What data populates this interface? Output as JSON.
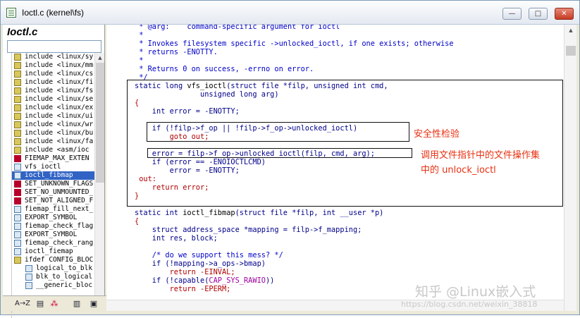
{
  "window": {
    "title": "Ioctl.c (kernel\\fs)",
    "minimize_label": "—",
    "maximize_label": "□",
    "close_label": "✕"
  },
  "left_panel": {
    "file_name": "Ioctl.c",
    "symbols": [
      {
        "icon": "include",
        "label": "include <linux/sy"
      },
      {
        "icon": "include",
        "label": "include <linux/mm"
      },
      {
        "icon": "include",
        "label": "include <linux/cs"
      },
      {
        "icon": "include",
        "label": "include <linux/fi"
      },
      {
        "icon": "include",
        "label": "include <linux/fs"
      },
      {
        "icon": "include",
        "label": "include <linux/se"
      },
      {
        "icon": "include",
        "label": "include <linux/ex"
      },
      {
        "icon": "include",
        "label": "include <linux/ui"
      },
      {
        "icon": "include",
        "label": "include <linux/wr"
      },
      {
        "icon": "include",
        "label": "include <linux/bu"
      },
      {
        "icon": "include",
        "label": "include <linux/fa"
      },
      {
        "icon": "include",
        "label": "include <asm/ioc"
      },
      {
        "icon": "define",
        "label": "FIEMAP_MAX_EXTEN"
      },
      {
        "icon": "function",
        "label": "vfs_ioctl"
      },
      {
        "icon": "function",
        "label": "ioctl_fibmap",
        "selected": true
      },
      {
        "icon": "define",
        "label": "SET_UNKNOWN_FLAGS"
      },
      {
        "icon": "define",
        "label": "SET_NO_UNMOUNTED_"
      },
      {
        "icon": "define",
        "label": "SET_NOT_ALIGNED_F"
      },
      {
        "icon": "function",
        "label": "fiemap_fill_next_"
      },
      {
        "icon": "function",
        "label": "EXPORT_SYMBOL"
      },
      {
        "icon": "function",
        "label": "fiemap_check_flag"
      },
      {
        "icon": "function",
        "label": "EXPORT_SYMBOL"
      },
      {
        "icon": "function",
        "label": "fiemap_check_rang"
      },
      {
        "icon": "function",
        "label": "ioctl_fiemap"
      },
      {
        "icon": "include",
        "label": "ifdef CONFIG_BLOC"
      },
      {
        "icon": "function",
        "label": "logical_to_blk",
        "sub": true
      },
      {
        "icon": "function",
        "label": "blk_to_logical",
        "sub": true
      },
      {
        "icon": "function",
        "label": "__generic_bloc",
        "sub": true
      }
    ]
  },
  "toolbar": {
    "sort_label": "A→Z"
  },
  "code": {
    "lines": [
      [
        {
          "t": " * @arg:    command-specific argument for ioctl",
          "c": "cm"
        }
      ],
      [
        {
          "t": " *",
          "c": "cm"
        }
      ],
      [
        {
          "t": " * Invokes filesystem specific ->unlocked_ioctl, if one exists; otherwise",
          "c": "cm"
        }
      ],
      [
        {
          "t": " * returns -ENOTTY.",
          "c": "cm"
        }
      ],
      [
        {
          "t": " *",
          "c": "cm"
        }
      ],
      [
        {
          "t": " * Returns 0 on success, -errno on error.",
          "c": "cm"
        }
      ],
      [
        {
          "t": " */",
          "c": "cm"
        }
      ],
      [
        {
          "t": "static long ",
          "c": "kw"
        },
        {
          "t": "vfs_ioctl",
          "c": ""
        },
        {
          "t": "(struct file *filp, unsigned int cmd,",
          "c": "kw"
        }
      ],
      [
        {
          "t": "               unsigned long arg)",
          "c": "kw"
        }
      ],
      [
        {
          "t": "{",
          "c": "rd"
        }
      ],
      [
        {
          "t": "    int error = -ENOTTY;",
          "c": "kw"
        }
      ],
      [
        {
          "t": "",
          "c": ""
        }
      ],
      [
        {
          "t": "    if (!filp->f_op || !filp->f_op->unlocked_ioctl)",
          "c": "kw"
        }
      ],
      [
        {
          "t": "        goto out;",
          "c": "rd"
        }
      ],
      [
        {
          "t": "",
          "c": ""
        }
      ],
      [
        {
          "t": "    error = filp->f_op->unlocked_ioctl(filp, cmd, arg);",
          "c": "kw"
        }
      ],
      [
        {
          "t": "    if (error == -ENOIOCTLCMD)",
          "c": "kw"
        }
      ],
      [
        {
          "t": "        error = -ENOTTY;",
          "c": "kw"
        }
      ],
      [
        {
          "t": " out:",
          "c": "rd"
        }
      ],
      [
        {
          "t": "    return error;",
          "c": "rd"
        }
      ],
      [
        {
          "t": "}",
          "c": "rd"
        }
      ],
      [
        {
          "t": "",
          "c": ""
        }
      ],
      [
        {
          "t": "static int ",
          "c": "kw"
        },
        {
          "t": "ioctl_fibmap",
          "c": ""
        },
        {
          "t": "(struct file *filp, int __user *p)",
          "c": "kw"
        }
      ],
      [
        {
          "t": "{",
          "c": "rd"
        }
      ],
      [
        {
          "t": "    struct address_space *mapping = filp->f_mapping;",
          "c": "kw"
        }
      ],
      [
        {
          "t": "    int res, block;",
          "c": "kw"
        }
      ],
      [
        {
          "t": "",
          "c": ""
        }
      ],
      [
        {
          "t": "    /* do we support this mess? */",
          "c": "cm"
        }
      ],
      [
        {
          "t": "    if (!mapping->a_ops->bmap)",
          "c": "kw"
        }
      ],
      [
        {
          "t": "        return -EINVAL;",
          "c": "rd"
        }
      ],
      [
        {
          "t": "    if (!capable(",
          "c": "kw"
        },
        {
          "t": "CAP_SYS_RAWIO",
          "c": "mg"
        },
        {
          "t": "))",
          "c": "kw"
        }
      ],
      [
        {
          "t": "        return -EPERM;",
          "c": "rd"
        }
      ]
    ]
  },
  "annotations": {
    "security_check": "安全性检验",
    "call_line1": "调用文件指针中的文件操作集",
    "call_line2": "中的 unlock_ioctl"
  },
  "watermark": {
    "main": "知乎 @Linux嵌入式",
    "url": "https://blog.csdn.net/weixin_38818"
  }
}
